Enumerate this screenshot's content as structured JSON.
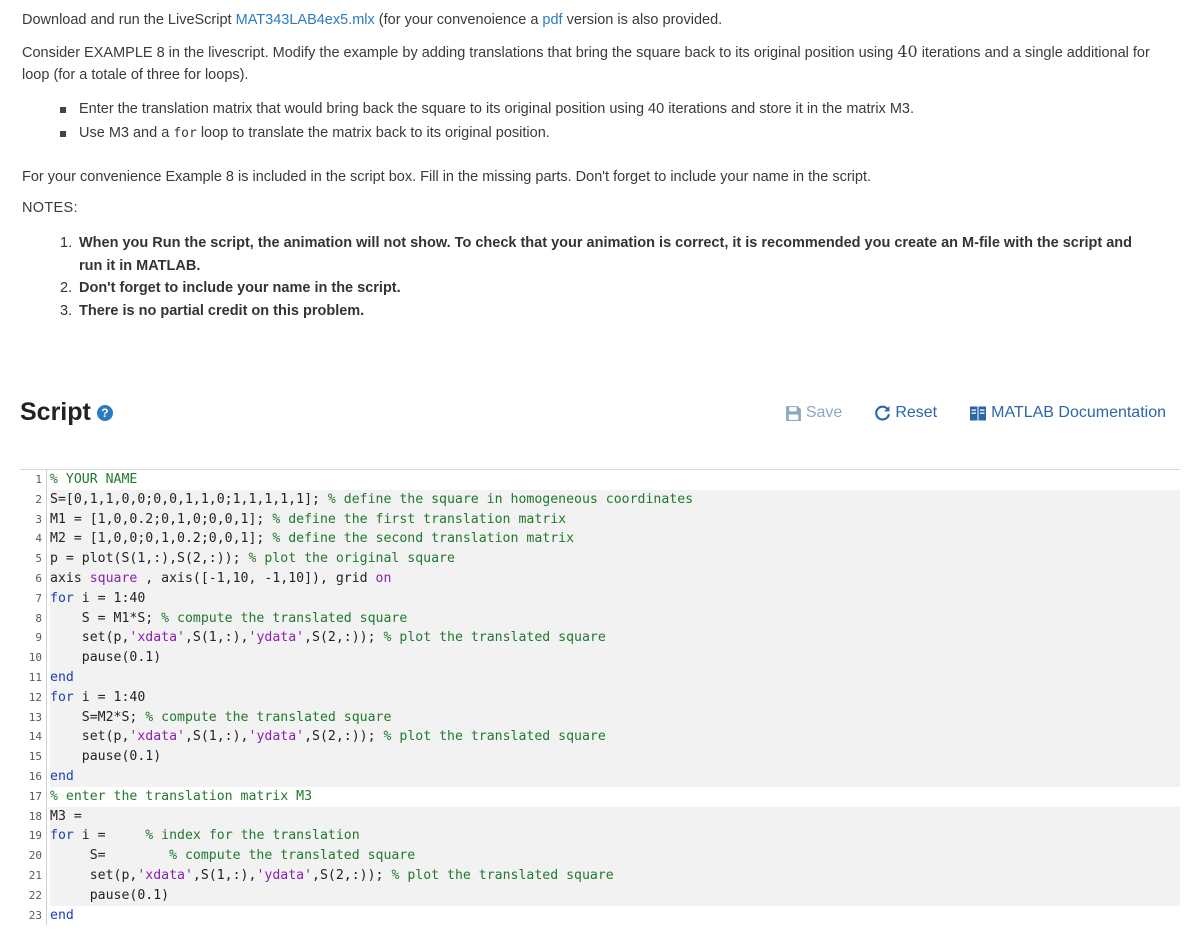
{
  "intro": {
    "p1_before": "Download and run the LiveScript ",
    "mlx_link": "MAT343LAB4ex5.mlx",
    "p1_middle": " (for your convenoience a ",
    "pdf_link": "pdf",
    "p1_after": " version is also provided.",
    "p2_before": "Consider  EXAMPLE 8 in the livescript. Modify the example by adding translations that bring  the square back to its original position using ",
    "p2_number": "40",
    "p2_after": " iterations and a single additional for loop (for a totale of three for loops).",
    "bullet1": "Enter the translation matrix that would bring back the square to its original position using 40 iterations and store it in the matrix M3.",
    "bullet2_before": "Use M3 and a ",
    "bullet2_code": "for",
    "bullet2_after": " loop to translate the matrix back to its original position.",
    "p3": "For your convenience Example 8 is included  in the script box. Fill in the missing parts. Don't forget to include your name in the script."
  },
  "notes": {
    "title": "NOTES:",
    "items": [
      {
        "num": "1.",
        "text": "When you Run the script, the animation will not show. To check that your animation is correct, it is recommended you create an M-file with the script and run it in MATLAB."
      },
      {
        "num": "2.",
        "text": "Don't forget to include your name in the script."
      },
      {
        "num": "3.",
        "text": "There is no partial credit on this problem."
      }
    ]
  },
  "script": {
    "title": "Script",
    "help_glyph": "?",
    "save_label": "Save",
    "reset_label": "Reset",
    "doc_label": "MATLAB Documentation"
  },
  "code_lines": [
    {
      "n": "1",
      "hl": false,
      "segs": [
        [
          "c",
          "% YOUR NAME"
        ]
      ]
    },
    {
      "n": "2",
      "hl": true,
      "segs": [
        [
          "t",
          "S=[0,1,1,0,0;0,0,1,1,0;1,1,1,1,1]; "
        ],
        [
          "c",
          "% define the square in homogeneous coordinates"
        ]
      ]
    },
    {
      "n": "3",
      "hl": true,
      "segs": [
        [
          "t",
          "M1 = [1,0,0.2;0,1,0;0,0,1]; "
        ],
        [
          "c",
          "% define the first translation matrix"
        ]
      ]
    },
    {
      "n": "4",
      "hl": true,
      "segs": [
        [
          "t",
          "M2 = [1,0,0;0,1,0.2;0,0,1]; "
        ],
        [
          "c",
          "% define the second translation matrix"
        ]
      ]
    },
    {
      "n": "5",
      "hl": true,
      "segs": [
        [
          "t",
          "p = plot(S(1,:),S(2,:)); "
        ],
        [
          "c",
          "% plot the original square"
        ]
      ]
    },
    {
      "n": "6",
      "hl": true,
      "segs": [
        [
          "t",
          "axis "
        ],
        [
          "s",
          "square"
        ],
        [
          "t",
          " , axis([-1,10, -1,10]), grid "
        ],
        [
          "s",
          "on"
        ]
      ]
    },
    {
      "n": "7",
      "hl": true,
      "segs": [
        [
          "k",
          "for"
        ],
        [
          "t",
          " i = 1:40"
        ]
      ]
    },
    {
      "n": "8",
      "hl": true,
      "segs": [
        [
          "t",
          "    S = M1*S; "
        ],
        [
          "c",
          "% compute the translated square"
        ]
      ]
    },
    {
      "n": "9",
      "hl": true,
      "segs": [
        [
          "t",
          "    set(p,"
        ],
        [
          "s",
          "'xdata'"
        ],
        [
          "t",
          ",S(1,:),"
        ],
        [
          "s",
          "'ydata'"
        ],
        [
          "t",
          ",S(2,:)); "
        ],
        [
          "c",
          "% plot the translated square"
        ]
      ]
    },
    {
      "n": "10",
      "hl": true,
      "segs": [
        [
          "t",
          "    pause(0.1)"
        ]
      ]
    },
    {
      "n": "11",
      "hl": true,
      "segs": [
        [
          "k",
          "end"
        ]
      ]
    },
    {
      "n": "12",
      "hl": true,
      "segs": [
        [
          "k",
          "for"
        ],
        [
          "t",
          " i = 1:40"
        ]
      ]
    },
    {
      "n": "13",
      "hl": true,
      "segs": [
        [
          "t",
          "    S=M2*S; "
        ],
        [
          "c",
          "% compute the translated square"
        ]
      ]
    },
    {
      "n": "14",
      "hl": true,
      "segs": [
        [
          "t",
          "    set(p,"
        ],
        [
          "s",
          "'xdata'"
        ],
        [
          "t",
          ",S(1,:),"
        ],
        [
          "s",
          "'ydata'"
        ],
        [
          "t",
          ",S(2,:)); "
        ],
        [
          "c",
          "% plot the translated square"
        ]
      ]
    },
    {
      "n": "15",
      "hl": true,
      "segs": [
        [
          "t",
          "    pause(0.1)"
        ]
      ]
    },
    {
      "n": "16",
      "hl": true,
      "segs": [
        [
          "k",
          "end"
        ]
      ]
    },
    {
      "n": "17",
      "hl": false,
      "segs": [
        [
          "c",
          "% enter the translation matrix M3"
        ]
      ]
    },
    {
      "n": "18",
      "hl": true,
      "segs": [
        [
          "t",
          "M3 ="
        ]
      ]
    },
    {
      "n": "19",
      "hl": true,
      "segs": [
        [
          "k",
          "for"
        ],
        [
          "t",
          " i =     "
        ],
        [
          "c",
          "% index for the translation"
        ]
      ]
    },
    {
      "n": "20",
      "hl": true,
      "segs": [
        [
          "t",
          "     S=        "
        ],
        [
          "c",
          "% compute the translated square"
        ]
      ]
    },
    {
      "n": "21",
      "hl": true,
      "segs": [
        [
          "t",
          "     set(p,"
        ],
        [
          "s",
          "'xdata'"
        ],
        [
          "t",
          ",S(1,:),"
        ],
        [
          "s",
          "'ydata'"
        ],
        [
          "t",
          ",S(2,:)); "
        ],
        [
          "c",
          "% plot the translated square"
        ]
      ]
    },
    {
      "n": "22",
      "hl": true,
      "segs": [
        [
          "t",
          "     pause(0.1)"
        ]
      ]
    },
    {
      "n": "23",
      "hl": false,
      "segs": [
        [
          "k",
          "end"
        ]
      ]
    }
  ]
}
